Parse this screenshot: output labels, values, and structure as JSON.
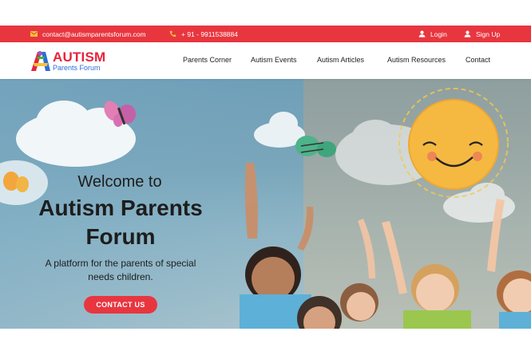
{
  "topbar": {
    "email": "contact@autismparentsforum.com",
    "phone": "+ 91 - 9911538884",
    "login": "Login",
    "signup": "Sign Up",
    "email_icon": "mail-icon",
    "phone_icon": "phone-icon",
    "user_icon": "user-icon"
  },
  "logo": {
    "title": "AUTISM",
    "subtitle": "Parents Forum"
  },
  "nav": [
    {
      "label": "Parents Corner"
    },
    {
      "label": "Autism Events"
    },
    {
      "label": "Autism Articles"
    },
    {
      "label": "Autism Resources"
    },
    {
      "label": "Contact"
    }
  ],
  "hero": {
    "welcome": "Welcome to",
    "title_line1": "Autism Parents",
    "title_line2": "Forum",
    "subtitle_line1": "A platform for the parents of special",
    "subtitle_line2": "needs children.",
    "cta": "CONTACT US"
  },
  "colors": {
    "brand_red": "#e8363f",
    "logo_blue": "#2b6fd6"
  }
}
